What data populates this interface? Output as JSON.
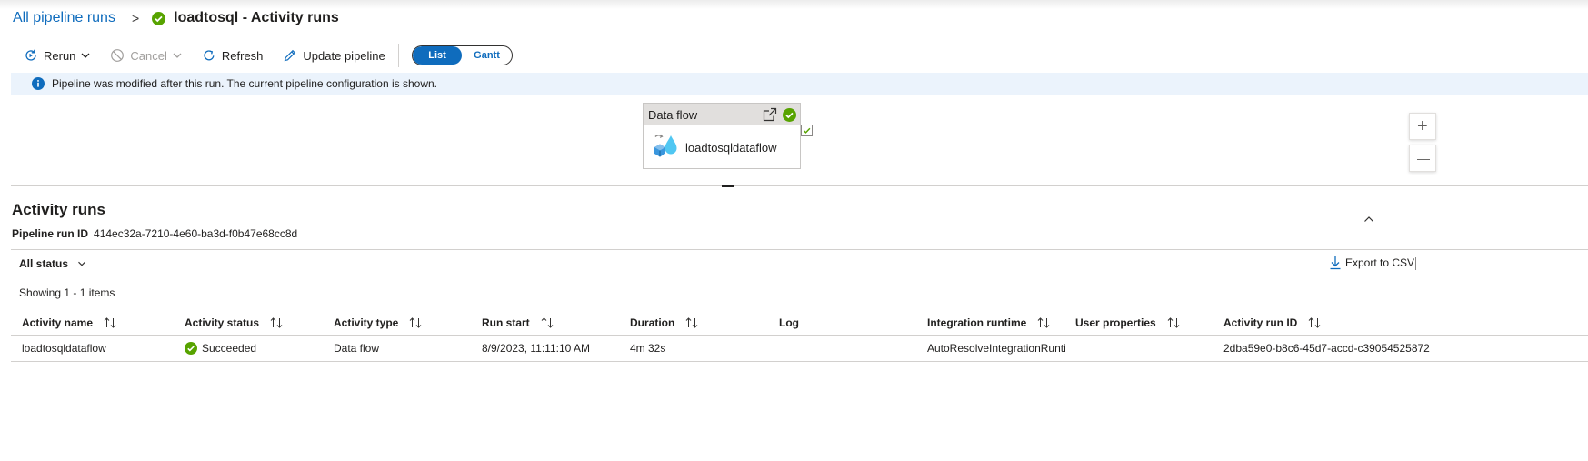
{
  "breadcrumb": {
    "root_label": "All pipeline runs",
    "separator": ">",
    "title": "loadtosql - Activity runs"
  },
  "toolbar": {
    "rerun_label": "Rerun",
    "cancel_label": "Cancel",
    "refresh_label": "Refresh",
    "update_label": "Update pipeline",
    "view_toggle": {
      "list_label": "List",
      "gantt_label": "Gantt",
      "selected": "List"
    }
  },
  "info_bar": {
    "message": "Pipeline was modified after this run. The current pipeline configuration is shown."
  },
  "canvas": {
    "node": {
      "type_label": "Data flow",
      "name": "loadtosqldataflow"
    },
    "zoom_in": "+",
    "zoom_out": "—"
  },
  "activity_runs": {
    "title": "Activity runs",
    "run_id_label": "Pipeline run ID",
    "run_id": "414ec32a-7210-4e60-ba3d-f0b47e68cc8d",
    "filter_label": "All status",
    "export_label": "Export to CSV",
    "showing": "Showing 1 - 1 items",
    "columns": [
      "Activity name",
      "Activity status",
      "Activity type",
      "Run start",
      "Duration",
      "Log",
      "Integration runtime",
      "User properties",
      "Activity run ID"
    ],
    "rows": [
      {
        "name": "loadtosqldataflow",
        "status": "Succeeded",
        "type": "Data flow",
        "run_start": "8/9/2023, 11:11:10 AM",
        "duration": "4m 32s",
        "log": "",
        "integration_runtime": "AutoResolveIntegrationRuntir",
        "user_properties": "",
        "run_id": "2dba59e0-b8c6-45d7-accd-c39054525872"
      }
    ]
  },
  "colors": {
    "accent": "#0f6cbd",
    "success": "#57a300",
    "info_bg": "#ebf3fc"
  }
}
